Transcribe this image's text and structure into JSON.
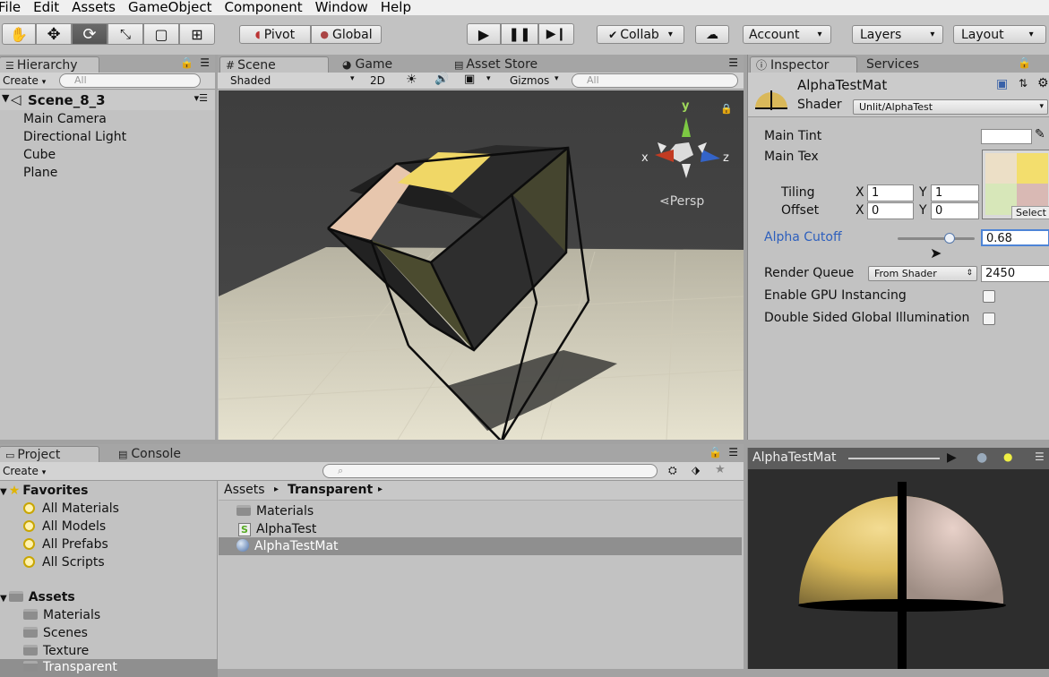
{
  "menu": [
    "File",
    "Edit",
    "Assets",
    "GameObject",
    "Component",
    "Window",
    "Help"
  ],
  "toolbar": {
    "pivot": "Pivot",
    "global": "Global",
    "collab": "Collab",
    "account": "Account",
    "layers": "Layers",
    "layout": "Layout"
  },
  "hierarchy": {
    "tab": "Hierarchy",
    "create": "Create",
    "search_placeholder": "All",
    "scene": "Scene_8_3",
    "items": [
      "Main Camera",
      "Directional Light",
      "Cube",
      "Plane"
    ]
  },
  "scene": {
    "tabs": [
      "Scene",
      "Game",
      "Asset Store"
    ],
    "shading": "Shaded",
    "mode2d": "2D",
    "gizmos": "Gizmos",
    "search_placeholder": "All",
    "persp": "Persp",
    "axis_x": "x",
    "axis_y": "y",
    "axis_z": "z"
  },
  "inspector": {
    "tabs": [
      "Inspector",
      "Services"
    ],
    "material_name": "AlphaTestMat",
    "shader_label": "Shader",
    "shader_value": "Unlit/AlphaTest",
    "main_tint": "Main Tint",
    "main_tex": "Main Tex",
    "tiling": "Tiling",
    "offset": "Offset",
    "x_label": "X",
    "y_label": "Y",
    "tiling_x": "1",
    "tiling_y": "1",
    "offset_x": "0",
    "offset_y": "0",
    "select": "Select",
    "alpha_cutoff": "Alpha Cutoff",
    "alpha_value": "0.68",
    "alpha_slider_fraction": 0.68,
    "render_queue": "Render Queue",
    "render_queue_mode": "From Shader",
    "render_queue_value": "2450",
    "gpu_instancing": "Enable GPU Instancing",
    "double_sided_gi": "Double Sided Global Illumination"
  },
  "project": {
    "tabs": [
      "Project",
      "Console"
    ],
    "create": "Create",
    "favorites": "Favorites",
    "fav_items": [
      "All Materials",
      "All Models",
      "All Prefabs",
      "All Scripts"
    ],
    "assets": "Assets",
    "asset_folders": [
      "Materials",
      "Scenes",
      "Texture",
      "Transparent"
    ],
    "breadcrumb": [
      "Assets",
      "Transparent"
    ],
    "files": [
      "Materials",
      "AlphaTest",
      "AlphaTestMat"
    ],
    "script_icon": "S"
  },
  "preview": {
    "title": "AlphaTestMat"
  },
  "colors": {
    "accent": "#3a72c4",
    "selected_row": "#8f8f8f",
    "panel": "#c2c2c2"
  }
}
